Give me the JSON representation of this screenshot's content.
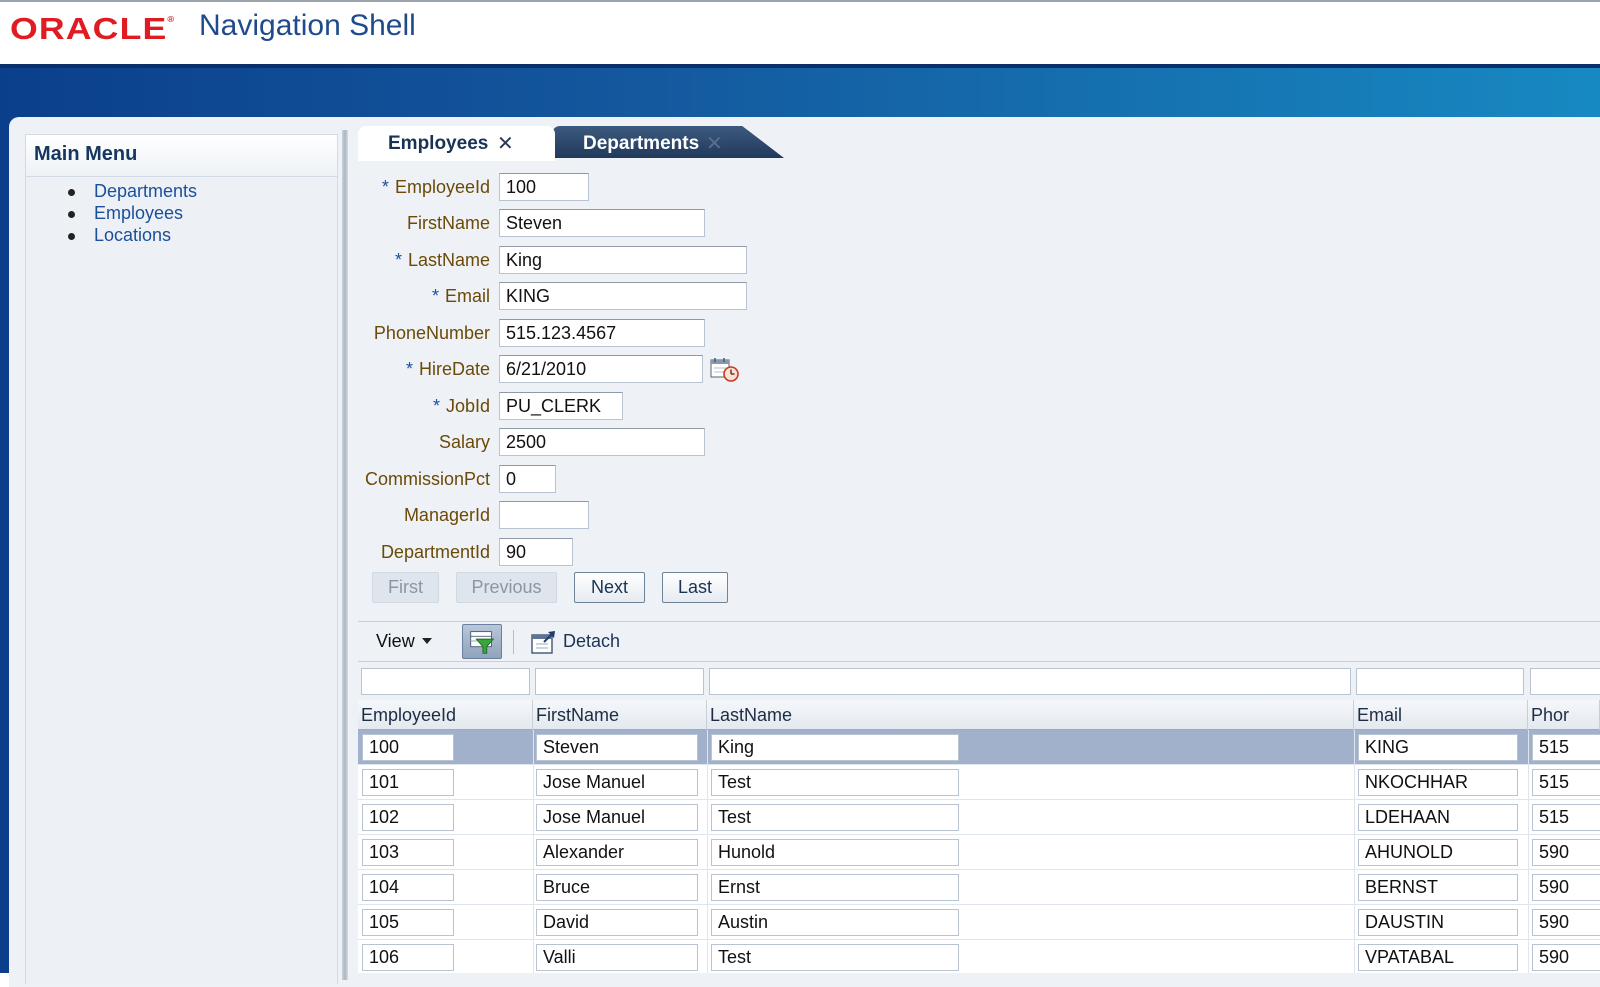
{
  "header": {
    "logo_text": "ORACLE",
    "logo_mark": "®",
    "app_title": "Navigation Shell"
  },
  "colors": {
    "oracle_red": "#e01b22",
    "title_blue": "#1f4b8c",
    "band_dark": "#0b3f8c",
    "band_light": "#1789c2",
    "label_brown": "#6b4a08",
    "selected_row": "#a2b1cb"
  },
  "main_menu": {
    "title": "Main Menu",
    "items": [
      {
        "label": "Departments"
      },
      {
        "label": "Employees"
      },
      {
        "label": "Locations"
      }
    ]
  },
  "tabs": [
    {
      "label": "Employees",
      "active": true,
      "close_icon": "close-icon"
    },
    {
      "label": "Departments",
      "active": false,
      "close_icon": "close-icon"
    }
  ],
  "form": {
    "required_mark": "*",
    "fields": [
      {
        "label": "EmployeeId",
        "value": "100",
        "required": true
      },
      {
        "label": "FirstName",
        "value": "Steven",
        "required": false
      },
      {
        "label": "LastName",
        "value": "King",
        "required": true
      },
      {
        "label": "Email",
        "value": "KING",
        "required": true
      },
      {
        "label": "PhoneNumber",
        "value": "515.123.4567",
        "required": false
      },
      {
        "label": "HireDate",
        "value": "6/21/2010",
        "required": true
      },
      {
        "label": "JobId",
        "value": "PU_CLERK",
        "required": true
      },
      {
        "label": "Salary",
        "value": "2500",
        "required": false
      },
      {
        "label": "CommissionPct",
        "value": "0",
        "required": false
      },
      {
        "label": "ManagerId",
        "value": "",
        "required": false
      },
      {
        "label": "DepartmentId",
        "value": "90",
        "required": false
      }
    ],
    "buttons": {
      "first": "First",
      "previous": "Previous",
      "next": "Next",
      "last": "Last"
    }
  },
  "toolbar": {
    "view_label": "View",
    "filter_icon": "query-by-example-icon",
    "detach_label": "Detach",
    "detach_icon": "detach-icon"
  },
  "table": {
    "columns": [
      "EmployeeId",
      "FirstName",
      "LastName",
      "Email",
      "Phor"
    ],
    "rows": [
      {
        "id": "100",
        "first": "Steven",
        "last": "King",
        "email": "KING",
        "phone": "515",
        "selected": true
      },
      {
        "id": "101",
        "first": "Jose Manuel",
        "last": "Test",
        "email": "NKOCHHAR",
        "phone": "515",
        "selected": false
      },
      {
        "id": "102",
        "first": "Jose Manuel",
        "last": "Test",
        "email": "LDEHAAN",
        "phone": "515",
        "selected": false
      },
      {
        "id": "103",
        "first": "Alexander",
        "last": "Hunold",
        "email": "AHUNOLD",
        "phone": "590",
        "selected": false
      },
      {
        "id": "104",
        "first": "Bruce",
        "last": "Ernst",
        "email": "BERNST",
        "phone": "590",
        "selected": false
      },
      {
        "id": "105",
        "first": "David",
        "last": "Austin",
        "email": "DAUSTIN",
        "phone": "590",
        "selected": false
      },
      {
        "id": "106",
        "first": "Valli",
        "last": "Test",
        "email": "VPATABAL",
        "phone": "590",
        "selected": false
      }
    ]
  }
}
